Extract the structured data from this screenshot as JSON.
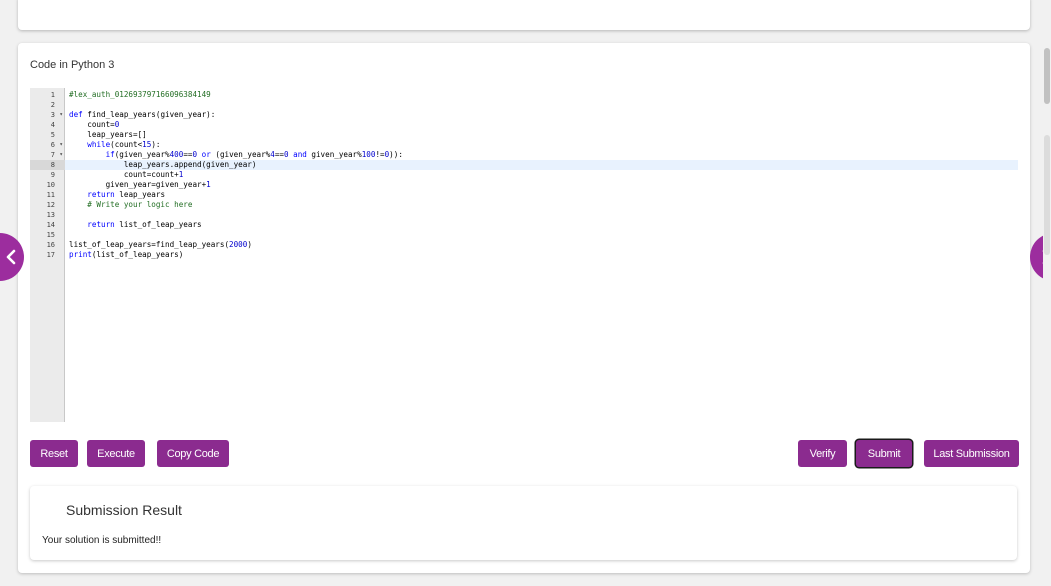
{
  "editor": {
    "language_title": "Code in Python 3",
    "active_line": 8,
    "lines": [
      {
        "n": "1",
        "fold": "",
        "text": "#lex_auth_012693797166096384149"
      },
      {
        "n": "2",
        "fold": "",
        "text": ""
      },
      {
        "n": "3",
        "fold": "▾",
        "text": "def find_leap_years(given_year):"
      },
      {
        "n": "4",
        "fold": "",
        "text": "    count=0"
      },
      {
        "n": "5",
        "fold": "",
        "text": "    leap_years=[]"
      },
      {
        "n": "6",
        "fold": "▾",
        "text": "    while(count<15):"
      },
      {
        "n": "7",
        "fold": "▾",
        "text": "        if(given_year%400==0 or (given_year%4==0 and given_year%100!=0)):"
      },
      {
        "n": "8",
        "fold": "",
        "text": "            leap_years.append(given_year)"
      },
      {
        "n": "9",
        "fold": "",
        "text": "            count=count+1"
      },
      {
        "n": "10",
        "fold": "",
        "text": "        given_year=given_year+1"
      },
      {
        "n": "11",
        "fold": "",
        "text": "    return leap_years"
      },
      {
        "n": "12",
        "fold": "",
        "text": "    # Write your logic here"
      },
      {
        "n": "13",
        "fold": "",
        "text": ""
      },
      {
        "n": "14",
        "fold": "",
        "text": "    return list_of_leap_years"
      },
      {
        "n": "15",
        "fold": "",
        "text": ""
      },
      {
        "n": "16",
        "fold": "",
        "text": "list_of_leap_years=find_leap_years(2000)"
      },
      {
        "n": "17",
        "fold": "",
        "text": "print(list_of_leap_years)"
      }
    ]
  },
  "buttons": {
    "reset": "Reset",
    "execute": "Execute",
    "copy_code": "Copy Code",
    "verify": "Verify",
    "submit": "Submit",
    "last_submission": "Last Submission"
  },
  "result": {
    "title": "Submission Result",
    "message": "Your solution is submitted!!"
  },
  "icons": {
    "prev": "chevron-left-icon",
    "next": "chevron-right-icon",
    "fold": "fold-arrow-icon"
  },
  "colors": {
    "accent": "#8b2b8f",
    "nav": "#9c2d9e",
    "active_line": "#e8f2fe",
    "keyword": "#0000ff",
    "comment": "#236e24",
    "number": "#0000cd"
  }
}
